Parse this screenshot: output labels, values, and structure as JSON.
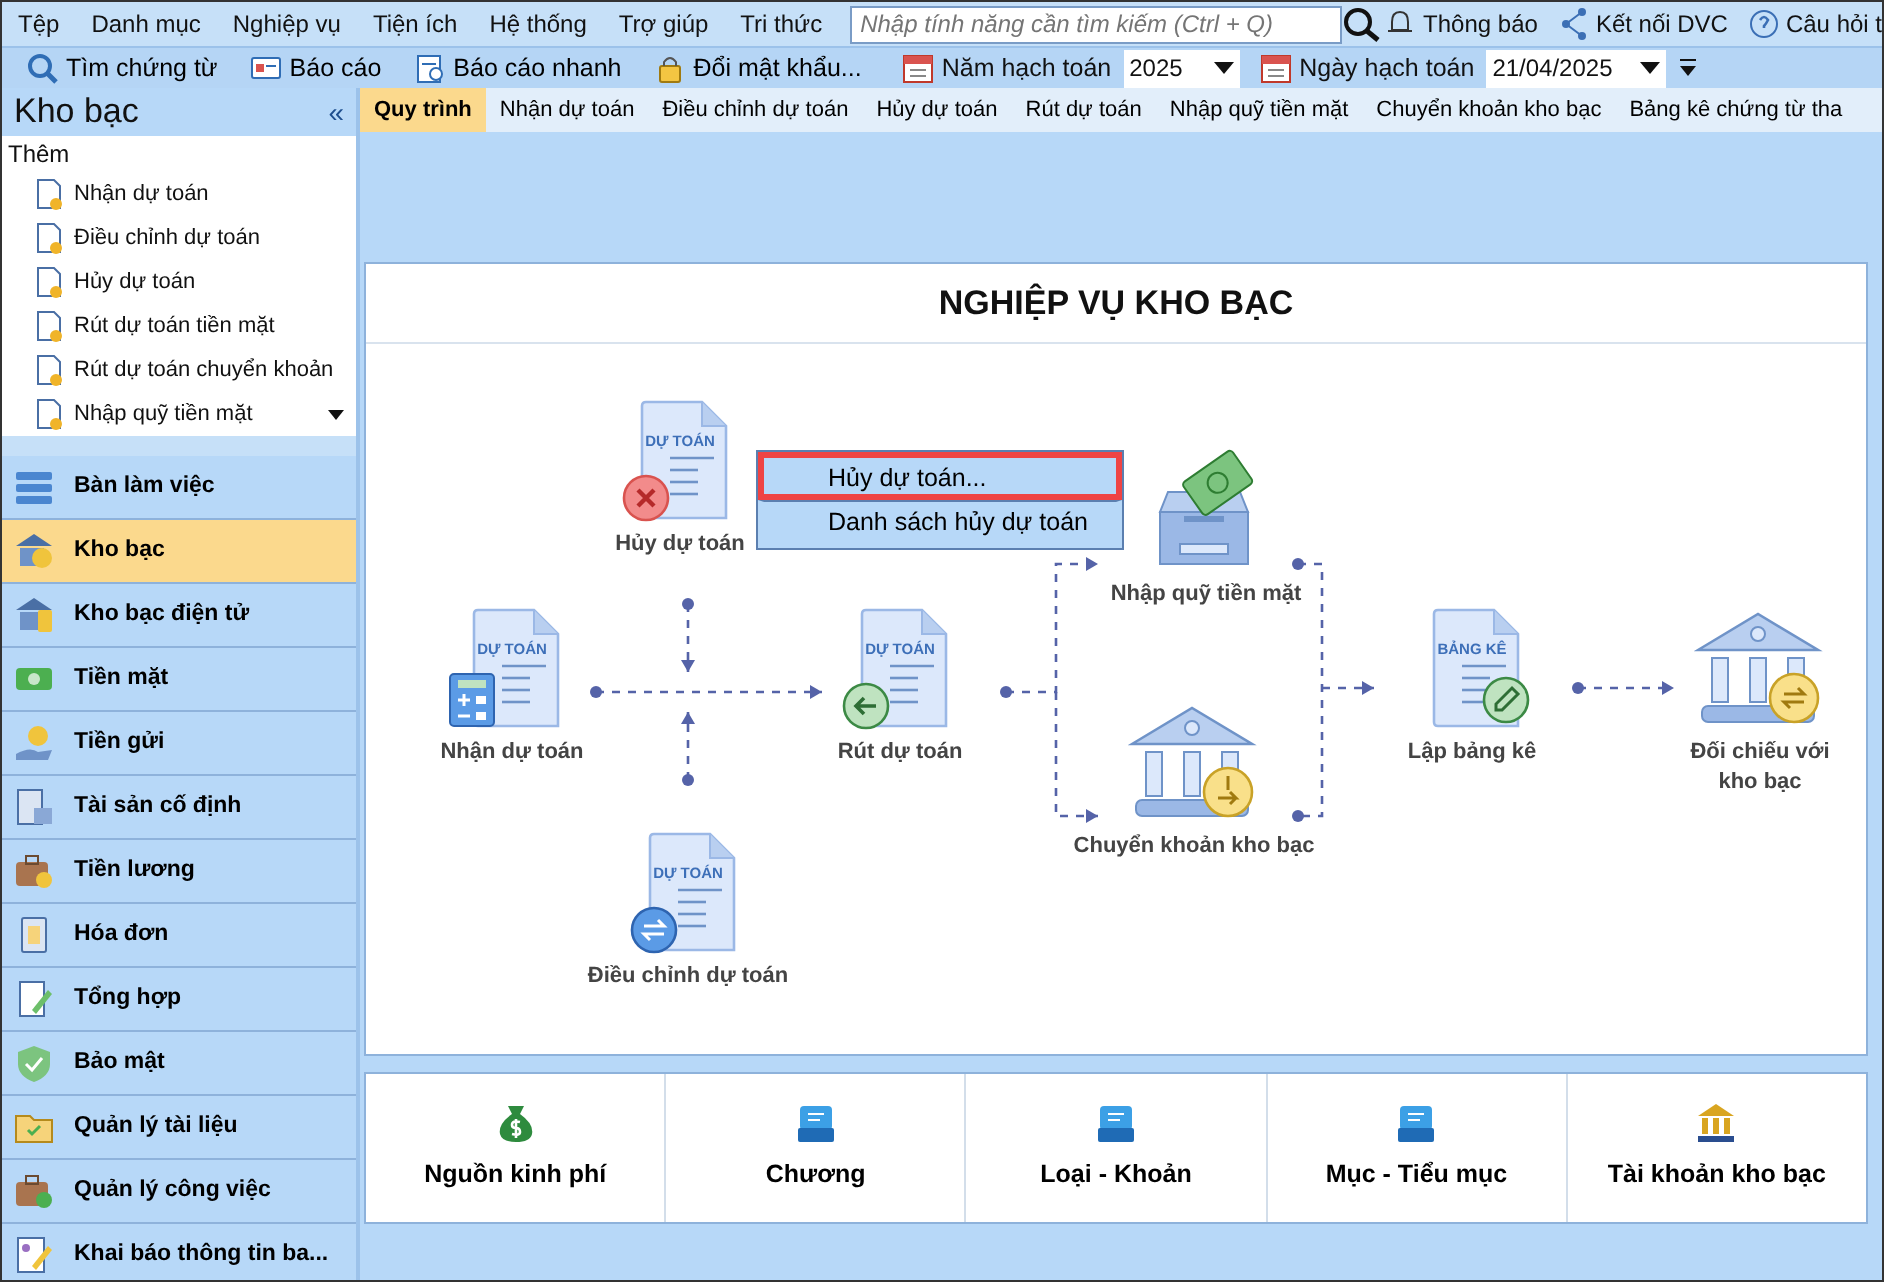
{
  "menu_bar": {
    "items": [
      "Tệp",
      "Danh mục",
      "Nghiệp vụ",
      "Tiện ích",
      "Hệ thống",
      "Trợ giúp",
      "Tri thức"
    ],
    "search": {
      "placeholder": "Nhập tính năng cần tìm kiếm (Ctrl + Q)"
    },
    "right_items": [
      "Thông báo",
      "Kết nối DVC",
      "Câu hỏi t"
    ]
  },
  "toolbar": {
    "buttons": [
      "Tìm chứng từ",
      "Báo cáo",
      "Báo cáo nhanh",
      "Đổi mật khẩu..."
    ],
    "fiscal_year": {
      "label": "Năm hạch toán",
      "value": "2025"
    },
    "posting_date": {
      "label": "Ngày hạch toán",
      "value": "21/04/2025"
    }
  },
  "sidebar": {
    "title": "Kho bạc",
    "collapse": "«",
    "add_section": {
      "title": "Thêm",
      "items": [
        "Nhận dự toán",
        "Điều chỉnh dự toán",
        "Hủy dự toán",
        "Rút dự toán tiền mặt",
        "Rút dự toán chuyển khoản",
        "Nhập quỹ tiền mặt"
      ]
    },
    "modules": [
      {
        "label": "Bàn làm việc",
        "selected": false
      },
      {
        "label": "Kho bạc",
        "selected": true
      },
      {
        "label": "Kho bạc điện tử",
        "selected": false
      },
      {
        "label": "Tiền mặt",
        "selected": false
      },
      {
        "label": "Tiền gửi",
        "selected": false
      },
      {
        "label": "Tài sản cố định",
        "selected": false
      },
      {
        "label": "Tiền lương",
        "selected": false
      },
      {
        "label": "Hóa đơn",
        "selected": false
      },
      {
        "label": "Tổng hợp",
        "selected": false
      },
      {
        "label": "Bảo mật",
        "selected": false
      },
      {
        "label": "Quản lý tài liệu",
        "selected": false
      },
      {
        "label": "Quản lý công việc",
        "selected": false
      },
      {
        "label": "Khai báo thông tin ba...",
        "selected": false
      }
    ]
  },
  "tabs": [
    {
      "label": "Quy trình",
      "selected": true
    },
    {
      "label": "Nhận dự toán",
      "selected": false
    },
    {
      "label": "Điều chỉnh dự toán",
      "selected": false
    },
    {
      "label": "Hủy dự toán",
      "selected": false
    },
    {
      "label": "Rút dự toán",
      "selected": false
    },
    {
      "label": "Nhập quỹ tiền mặt",
      "selected": false
    },
    {
      "label": "Chuyển khoản kho bạc",
      "selected": false
    },
    {
      "label": "Bảng kê chứng từ tha",
      "selected": false
    }
  ],
  "diagram": {
    "title": "NGHIỆP VỤ KHO BẠC",
    "nodes": [
      {
        "label": "Hủy dự toán",
        "kind": "document",
        "caption": "DỰ TOÁN"
      },
      {
        "label": "Nhận dự toán",
        "kind": "document",
        "caption": "DỰ TOÁN"
      },
      {
        "label": "Rút dự toán",
        "kind": "document",
        "caption": "DỰ TOÁN"
      },
      {
        "label": "Điều chỉnh dự toán",
        "kind": "document",
        "caption": "DỰ TOÁN"
      },
      {
        "label": "Nhập quỹ tiền mặt",
        "kind": "cashbox"
      },
      {
        "label": "Chuyển khoản kho bạc",
        "kind": "bank"
      },
      {
        "label": "Lập bảng kê",
        "kind": "document",
        "caption": "BẢNG KÊ"
      },
      {
        "label": "Đối chiếu với kho bạc",
        "kind": "bank"
      }
    ]
  },
  "context_menu": {
    "items": [
      {
        "label": "Hủy dự toán...",
        "selected": true
      },
      {
        "label": "Danh sách hủy dự toán",
        "selected": false
      }
    ]
  },
  "catalog": [
    {
      "label": "Nguồn kinh phí",
      "kind": "money"
    },
    {
      "label": "Chương",
      "kind": "tray"
    },
    {
      "label": "Loại - Khoản",
      "kind": "tray"
    },
    {
      "label": "Mục - Tiểu mục",
      "kind": "tray"
    },
    {
      "label": "Tài khoản kho bạc",
      "kind": "bank"
    }
  ]
}
